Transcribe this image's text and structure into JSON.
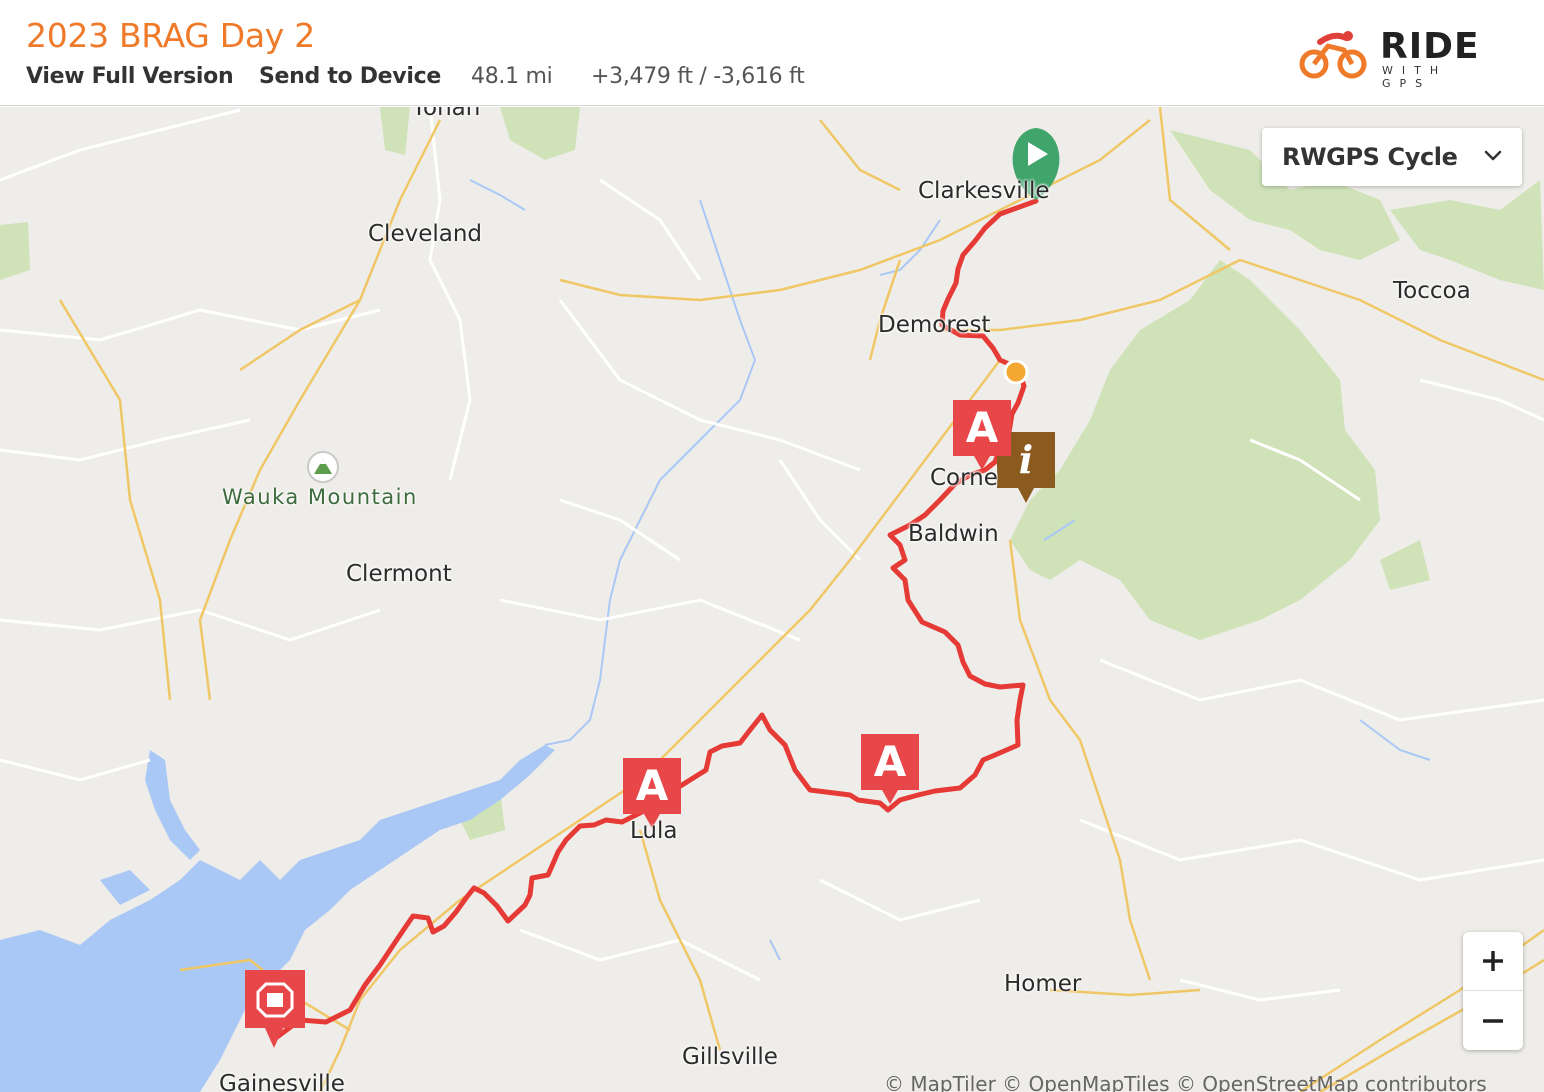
{
  "header": {
    "title": "2023 BRAG Day 2",
    "view_full": "View Full Version",
    "send_device": "Send to Device",
    "distance": "48.1 mi",
    "elevation": "+3,479 ft / -3,616 ft",
    "logo_main": "RIDE",
    "logo_sub": "WITH GPS"
  },
  "map": {
    "style_selector": "RWGPS Cycle",
    "places": [
      "Yonah",
      "Cleveland",
      "Clarkesville",
      "Demorest",
      "Toccoa",
      "Cornelia",
      "Baldwin",
      "Clermont",
      "Lula",
      "Homer",
      "Gillsville",
      "Gainesville"
    ],
    "poi": "Wauka Mountain",
    "marker_letter": "A",
    "info_glyph": "i",
    "attribution": "© MapTiler © OpenMapTiles © OpenStreetMap contributors"
  },
  "colors": {
    "brand_orange": "#ef7a2a",
    "route_red": "#e53a35",
    "marker_red": "#e8474a",
    "start_green": "#3fa56b",
    "water_blue": "#a9c8f5",
    "park_green": "#cfe2b8"
  }
}
